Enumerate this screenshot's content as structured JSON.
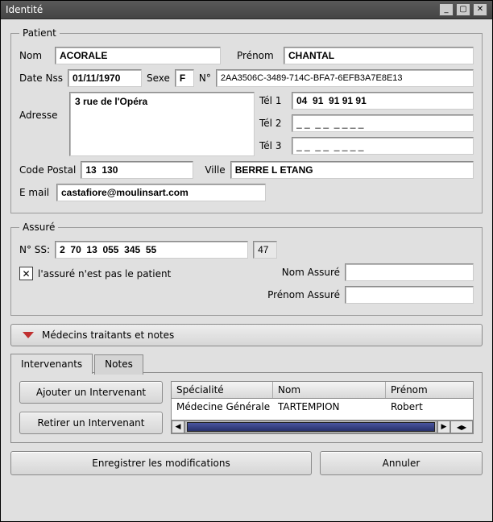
{
  "window": {
    "title": "Identité"
  },
  "patient": {
    "legend": "Patient",
    "nom_label": "Nom",
    "nom": "ACORALE",
    "prenom_label": "Prénom",
    "prenom": "CHANTAL",
    "datenss_label": "Date Nss",
    "datenss": "01/11/1970",
    "sexe_label": "Sexe",
    "sexe": "F",
    "n_label": "N°",
    "n": "2AA3506C-3489-714C-BFA7-6EFB3A7E8E13",
    "adresse_label": "Adresse",
    "adresse": "3 rue de l'Opéra",
    "tel1_label": "Tél 1",
    "tel1": "04  91  91 91 91",
    "tel2_label": "Tél 2",
    "tel2": "_ _  _ _  _ _ _ _",
    "tel3_label": "Tél 3",
    "tel3": "_ _  _ _  _ _ _ _",
    "cp_label": "Code Postal",
    "cp": "13  130",
    "ville_label": "Ville",
    "ville": "BERRE L ETANG",
    "email_label": "E mail",
    "email": "castafiore@moulinsart.com"
  },
  "assure": {
    "legend": "Assuré",
    "nss_label": "N° SS:",
    "nss": "2  70  13  055  345  55",
    "nss_key": "47",
    "not_patient_label": "l'assuré n'est pas le patient",
    "not_patient_checked": true,
    "nom_label": "Nom Assuré",
    "nom": "",
    "prenom_label": "Prénom Assuré",
    "prenom": ""
  },
  "toggle": {
    "label": "Médecins traitants et notes"
  },
  "tabs": {
    "intervenants": "Intervenants",
    "notes": "Notes"
  },
  "intervenants": {
    "add_label": "Ajouter un Intervenant",
    "remove_label": "Retirer un Intervenant",
    "headers": {
      "spec": "Spécialité",
      "nom": "Nom",
      "prenom": "Prénom"
    },
    "rows": [
      {
        "spec": "Médecine Générale",
        "nom": "TARTEMPION",
        "prenom": "Robert"
      }
    ]
  },
  "footer": {
    "save": "Enregistrer les modifications",
    "cancel": "Annuler"
  }
}
